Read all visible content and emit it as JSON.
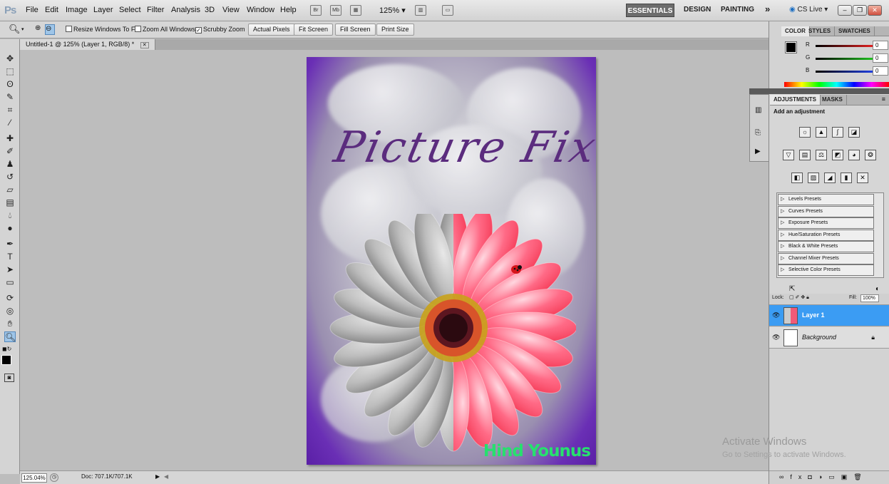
{
  "app": {
    "logo": "Ps"
  },
  "menu": [
    "File",
    "Edit",
    "Image",
    "Layer",
    "Select",
    "Filter",
    "Analysis",
    "3D",
    "View",
    "Window",
    "Help"
  ],
  "appbar": {
    "icon_br": "Br",
    "icon_mb": "Mb",
    "zoom": "125%",
    "workspaces": [
      "ESSENTIALS",
      "DESIGN",
      "PAINTING"
    ],
    "more": "»",
    "cslive": "CS Live"
  },
  "options": {
    "resize_windows": "Resize Windows To Fit",
    "zoom_all": "Zoom All Windows",
    "scrubby": "Scrubby Zoom",
    "buttons": [
      "Actual Pixels",
      "Fit Screen",
      "Fill Screen",
      "Print Size"
    ]
  },
  "document": {
    "tab": "Untitled-1 @ 125% (Layer 1, RGB/8) *",
    "title": "Picture Fixer",
    "signature": "Hind Younus"
  },
  "status": {
    "zoom": "125.04%",
    "doc": "Doc: 707.1K/707.1K"
  },
  "color_panel": {
    "tabs": [
      "COLOR",
      "STYLES",
      "SWATCHES"
    ],
    "channels": [
      {
        "label": "R",
        "value": "0",
        "color": "#e02020"
      },
      {
        "label": "G",
        "value": "0",
        "color": "#20c020"
      },
      {
        "label": "B",
        "value": "0",
        "color": "#2040e0"
      }
    ]
  },
  "adjustments_panel": {
    "tabs": [
      "ADJUSTMENTS",
      "MASKS"
    ],
    "heading": "Add an adjustment",
    "presets": [
      "Levels Presets",
      "Curves Presets",
      "Exposure Presets",
      "Hue/Saturation Presets",
      "Black & White Presets",
      "Channel Mixer Presets",
      "Selective Color Presets"
    ]
  },
  "layers_panel": {
    "lock_label": "Lock:",
    "fill_label": "Fill:",
    "fill_value": "100%",
    "layers": [
      {
        "name": "Layer 1",
        "selected": true
      },
      {
        "name": "Background",
        "selected": false,
        "locked": true
      }
    ]
  },
  "watermark": {
    "line1": "Activate Windows",
    "line2": "Go to Settings to activate Windows."
  }
}
